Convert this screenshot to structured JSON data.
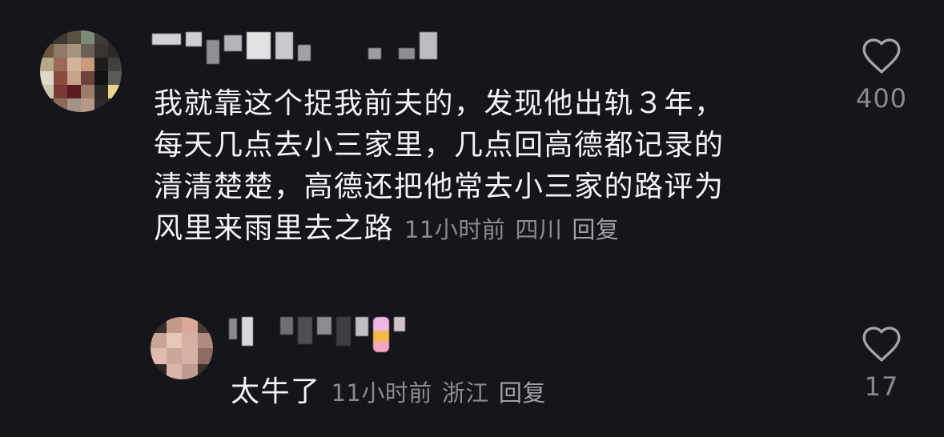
{
  "comments": [
    {
      "text_lines": [
        "我就靠这个捉我前夫的，发现他出轨３年，",
        "每天几点去小三家里，几点回高德都记录的",
        "清清楚楚，高德还把他常去小三家的路评为",
        "风里来雨里去之路"
      ],
      "time": "11小时前",
      "location": "四川",
      "reply_label": "回复",
      "like_count": "400",
      "like_icon": "heart-outline-icon"
    },
    {
      "text_lines": [
        "太牛了"
      ],
      "time": "11小时前",
      "location": "浙江",
      "reply_label": "回复",
      "like_count": "17",
      "like_icon": "heart-outline-icon"
    }
  ],
  "colors": {
    "background": "#16151b",
    "text": "#f4f4f6",
    "meta": "#8b8a93"
  }
}
